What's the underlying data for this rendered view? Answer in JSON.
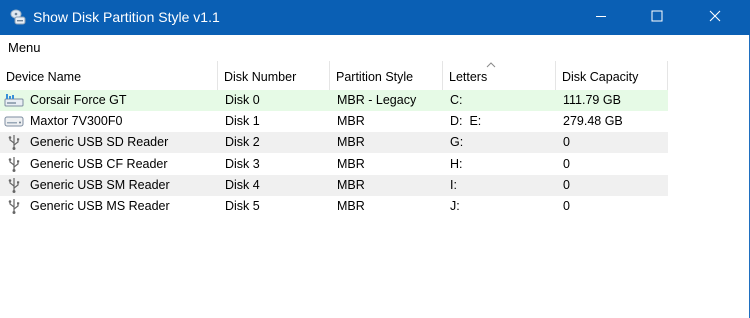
{
  "window": {
    "title": "Show Disk Partition Style v1.1",
    "icon": "disk-app-icon",
    "controls": {
      "minimize": "minimize-icon",
      "maximize": "maximize-icon",
      "close": "close-icon"
    },
    "accent_color": "#0a5fb4"
  },
  "menu": {
    "label": "Menu"
  },
  "table": {
    "sorted_column": "Letters",
    "selected_row_color": "#e6fae6",
    "columns": [
      "Device Name",
      "Disk Number",
      "Partition Style",
      "Letters",
      "Disk Capacity"
    ],
    "rows": [
      {
        "icon": "ssd-icon",
        "device": "Corsair Force GT",
        "disk": "Disk 0",
        "style": "MBR - Legacy",
        "letters": "C:",
        "capacity": "111.79 GB"
      },
      {
        "icon": "hdd-icon",
        "device": "Maxtor 7V300F0",
        "disk": "Disk 1",
        "style": "MBR",
        "letters": "D:  E:",
        "capacity": "279.48 GB"
      },
      {
        "icon": "usb-icon",
        "device": "Generic USB SD Reader",
        "disk": "Disk 2",
        "style": "MBR",
        "letters": "G:",
        "capacity": "0"
      },
      {
        "icon": "usb-icon",
        "device": "Generic USB CF Reader",
        "disk": "Disk 3",
        "style": "MBR",
        "letters": "H:",
        "capacity": "0"
      },
      {
        "icon": "usb-icon",
        "device": "Generic USB SM Reader",
        "disk": "Disk 4",
        "style": "MBR",
        "letters": "I:",
        "capacity": "0"
      },
      {
        "icon": "usb-icon",
        "device": "Generic USB MS Reader",
        "disk": "Disk 5",
        "style": "MBR",
        "letters": "J:",
        "capacity": "0"
      }
    ]
  }
}
